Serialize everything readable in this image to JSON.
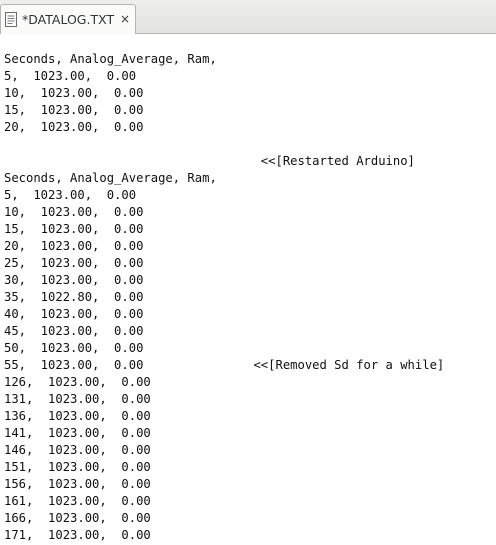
{
  "tab": {
    "title": "*DATALOG.TXT",
    "close_glyph": "×",
    "icon": "text-document-icon"
  },
  "editor": {
    "lines": [
      "",
      "Seconds, Analog_Average, Ram,",
      "5,  1023.00,  0.00",
      "10,  1023.00,  0.00",
      "15,  1023.00,  0.00",
      "20,  1023.00,  0.00",
      "",
      "                                   <<[Restarted Arduino]",
      "Seconds, Analog_Average, Ram,",
      "5,  1023.00,  0.00",
      "10,  1023.00,  0.00",
      "15,  1023.00,  0.00",
      "20,  1023.00,  0.00",
      "25,  1023.00,  0.00",
      "30,  1023.00,  0.00",
      "35,  1022.80,  0.00",
      "40,  1023.00,  0.00",
      "45,  1023.00,  0.00",
      "50,  1023.00,  0.00",
      "55,  1023.00,  0.00               <<[Removed Sd for a while]",
      "126,  1023.00,  0.00",
      "131,  1023.00,  0.00",
      "136,  1023.00,  0.00",
      "141,  1023.00,  0.00",
      "146,  1023.00,  0.00",
      "151,  1023.00,  0.00",
      "156,  1023.00,  0.00",
      "161,  1023.00,  0.00",
      "166,  1023.00,  0.00",
      "171,  1023.00,  0.00"
    ]
  }
}
